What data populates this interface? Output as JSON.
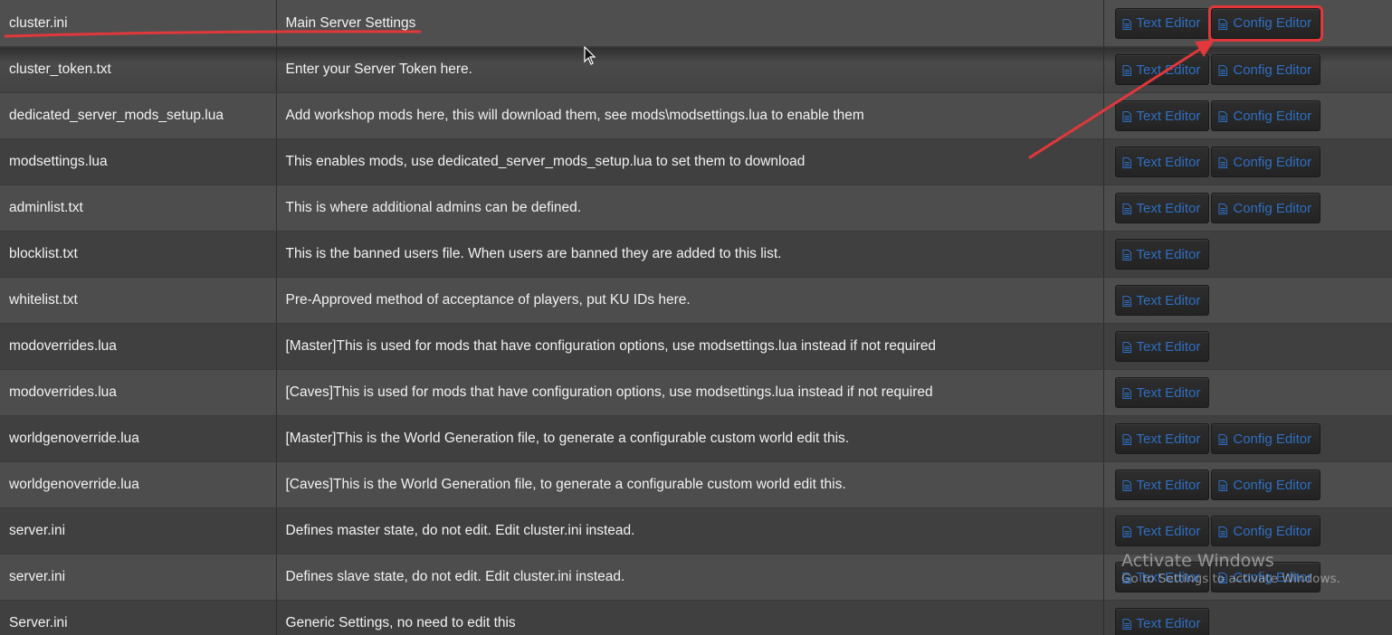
{
  "buttons": {
    "text_editor": "Text Editor",
    "config_editor": "Config Editor"
  },
  "rows": [
    {
      "file": "cluster.ini",
      "description": "Main Server Settings",
      "config": true
    },
    {
      "file": "cluster_token.txt",
      "description": "Enter your Server Token here.",
      "config": true
    },
    {
      "file": "dedicated_server_mods_setup.lua",
      "description": "Add workshop mods here, this will download them, see mods\\modsettings.lua to enable them",
      "config": true
    },
    {
      "file": "modsettings.lua",
      "description": "This enables mods, use dedicated_server_mods_setup.lua to set them to download",
      "config": true
    },
    {
      "file": "adminlist.txt",
      "description": "This is where additional admins can be defined.",
      "config": true
    },
    {
      "file": "blocklist.txt",
      "description": "This is the banned users file. When users are banned they are added to this list.",
      "config": false
    },
    {
      "file": "whitelist.txt",
      "description": "Pre-Approved method of acceptance of players, put KU IDs here.",
      "config": false
    },
    {
      "file": "modoverrides.lua",
      "description": "[Master]This is used for mods that have configuration options, use modsettings.lua instead if not required",
      "config": false
    },
    {
      "file": "modoverrides.lua",
      "description": "[Caves]This is used for mods that have configuration options, use modsettings.lua instead if not required",
      "config": false
    },
    {
      "file": "worldgenoverride.lua",
      "description": "[Master]This is the World Generation file, to generate a configurable custom world edit this.",
      "config": true
    },
    {
      "file": "worldgenoverride.lua",
      "description": "[Caves]This is the World Generation file, to generate a configurable custom world edit this.",
      "config": true
    },
    {
      "file": "server.ini",
      "description": "Defines master state, do not edit. Edit cluster.ini instead.",
      "config": true
    },
    {
      "file": "server.ini",
      "description": "Defines slave state, do not edit. Edit cluster.ini instead.",
      "config": true
    },
    {
      "file": "Server.ini",
      "description": "Generic Settings, no need to edit this",
      "config": false
    }
  ],
  "watermark": {
    "title": "Activate Windows",
    "subtitle": "Go to Settings to activate Windows."
  },
  "colors": {
    "button_text": "#2f6fc2",
    "annotation": "#e0383b",
    "row_odd": "#4d4d4d",
    "row_even": "#404040"
  },
  "icons": {
    "button_icon": "file-text-icon"
  }
}
